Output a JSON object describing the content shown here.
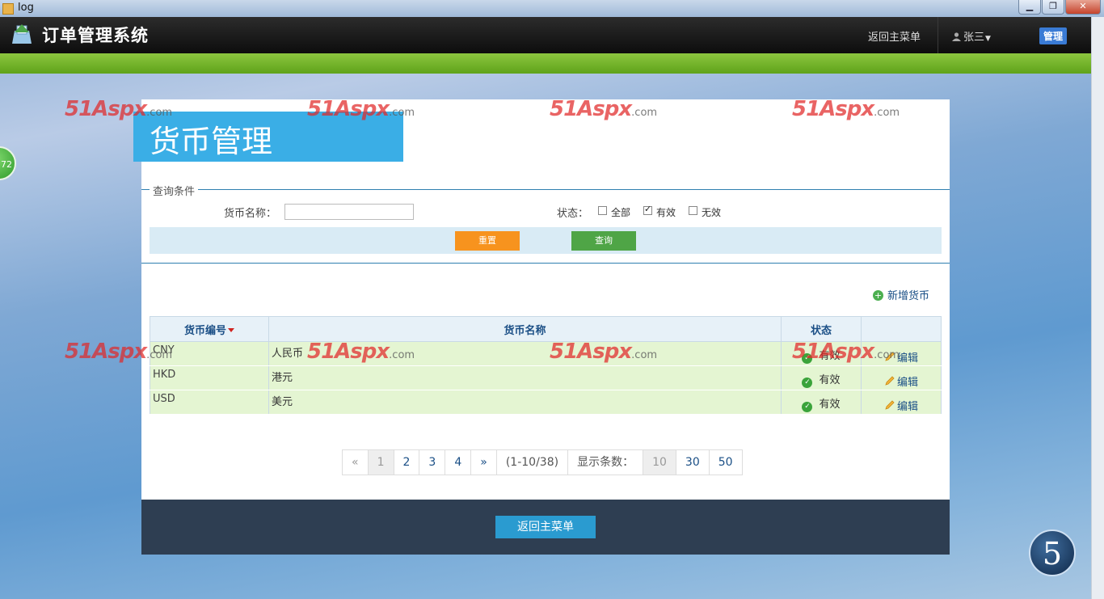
{
  "window": {
    "title": "log"
  },
  "header": {
    "brand": "订单管理系统",
    "back_to_menu": "返回主菜单",
    "user": "张三",
    "admin_label": "管理"
  },
  "side_badge": "72",
  "page_title": "货币管理",
  "query": {
    "legend": "查询条件",
    "name_label": "货币名称：",
    "name_value": "",
    "status_label": "状态：",
    "options": [
      {
        "label": "全部",
        "checked": false
      },
      {
        "label": "有效",
        "checked": true
      },
      {
        "label": "无效",
        "checked": false
      }
    ],
    "reset_label": "重置",
    "search_label": "查询"
  },
  "add_currency": "新增货币",
  "table": {
    "headers": {
      "code": "货币编号",
      "name": "货币名称",
      "status": "状态",
      "op": ""
    },
    "rows": [
      {
        "code": "CNY",
        "name": "人民币",
        "status": "有效",
        "action": "编辑"
      },
      {
        "code": "HKD",
        "name": "港元",
        "status": "有效",
        "action": "编辑"
      },
      {
        "code": "USD",
        "name": "美元",
        "status": "有效",
        "action": "编辑"
      }
    ]
  },
  "pager": {
    "prev": "«",
    "pages": [
      "1",
      "2",
      "3",
      "4"
    ],
    "current_page": "1",
    "next": "»",
    "range": "(1-10/38)",
    "size_label": "显示条数：",
    "sizes": [
      "10",
      "30",
      "50"
    ],
    "current_size": "10"
  },
  "footer": {
    "back_label": "返回主菜单"
  },
  "corner_badge": "5",
  "watermark": {
    "main": "51Aspx",
    "suffix": ".com"
  },
  "colors": {
    "header_bg": "#111111",
    "green_bar": "#6db52a",
    "title_bg": "#3aaee6",
    "reset_btn": "#f7931e",
    "query_btn": "#4fa546",
    "footer_bg": "#2e3e52",
    "row_bg": "#e4f5d2"
  }
}
